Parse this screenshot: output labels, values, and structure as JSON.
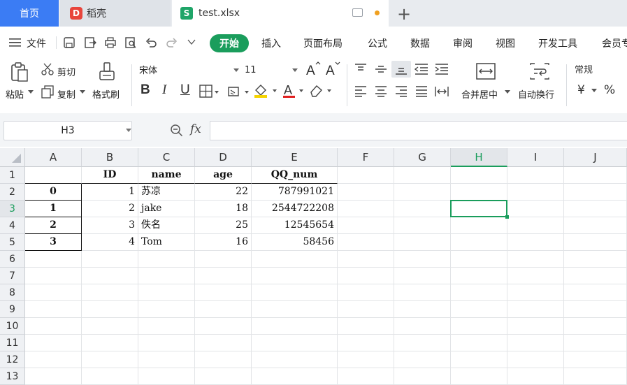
{
  "tabs": {
    "home": "首页",
    "daoke": "稻壳",
    "file": "test.xlsx",
    "daoke_logo": "D",
    "file_logo": "S"
  },
  "menu": {
    "file": "文件",
    "start": "开始",
    "insert": "插入",
    "layout": "页面布局",
    "formula": "公式",
    "data": "数据",
    "review": "审阅",
    "view": "视图",
    "dev": "开发工具",
    "member": "会员专"
  },
  "ribbon": {
    "paste": "粘贴",
    "cut": "剪切",
    "copy": "复制",
    "format_painter": "格式刷",
    "font_name": "宋体",
    "font_size": "11",
    "merge_center": "合并居中",
    "wrap": "自动换行",
    "number_format": "常规",
    "currency_symbol": "¥",
    "percent_symbol": "%"
  },
  "formula_bar": {
    "name_box": "H3",
    "fx": "fx",
    "formula": ""
  },
  "columns": [
    "A",
    "B",
    "C",
    "D",
    "E",
    "F",
    "G",
    "H",
    "I",
    "J"
  ],
  "rows": [
    "1",
    "2",
    "3",
    "4",
    "5",
    "6",
    "7",
    "8",
    "9",
    "10",
    "11",
    "12",
    "13"
  ],
  "header_row": [
    "",
    "ID",
    "name",
    "age",
    "QQ_num"
  ],
  "data_rows": [
    {
      "idx": "0",
      "id": "1",
      "name": "苏凉",
      "age": "22",
      "qq": "787991021"
    },
    {
      "idx": "1",
      "id": "2",
      "name": "jake",
      "age": "18",
      "qq": "2544722208"
    },
    {
      "idx": "2",
      "id": "3",
      "name": "佚名",
      "age": "25",
      "qq": "12545654"
    },
    {
      "idx": "3",
      "id": "4",
      "name": "Tom",
      "age": "16",
      "qq": "58456"
    }
  ],
  "selected_cell": "H3",
  "accent_color": "#1a9d5c",
  "home_tab_color": "#3b7cf4"
}
